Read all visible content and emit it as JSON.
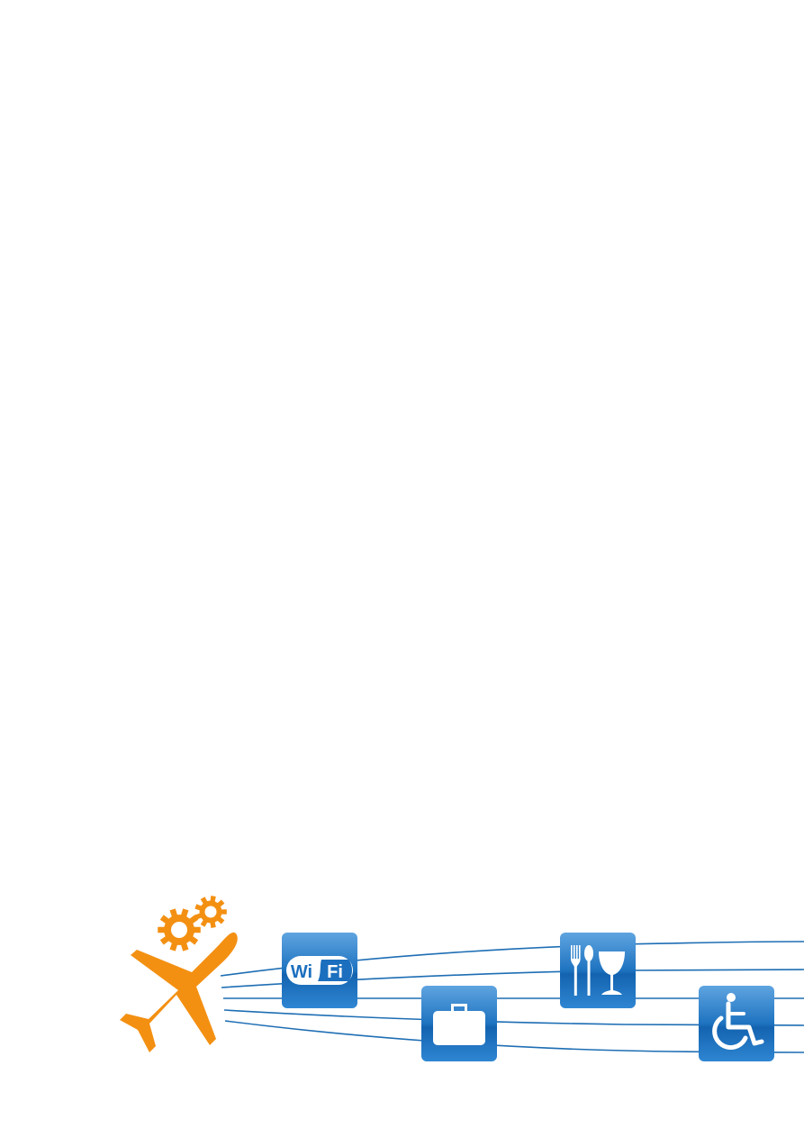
{
  "colors": {
    "background": "#ffffff",
    "airplane": "#F39012",
    "gears": "#F39012",
    "flight_lines": "#1E6EB4",
    "tile_top": "#5FA4E0",
    "tile_bottom": "#1363B0",
    "icon_glyph": "#ffffff"
  },
  "illustration": {
    "airplane": {
      "icon": "airplane-icon"
    },
    "gears": [
      {
        "icon": "gear-icon"
      },
      {
        "icon": "gear-icon"
      }
    ],
    "service_tiles": [
      {
        "name": "wifi-tile",
        "icon": "wifi-icon",
        "labels": [
          "Wi",
          "Fi"
        ]
      },
      {
        "name": "baggage-tile",
        "icon": "suitcase-icon"
      },
      {
        "name": "dining-tile",
        "icon": "dining-icon"
      },
      {
        "name": "accessibility-tile",
        "icon": "wheelchair-icon"
      }
    ]
  }
}
